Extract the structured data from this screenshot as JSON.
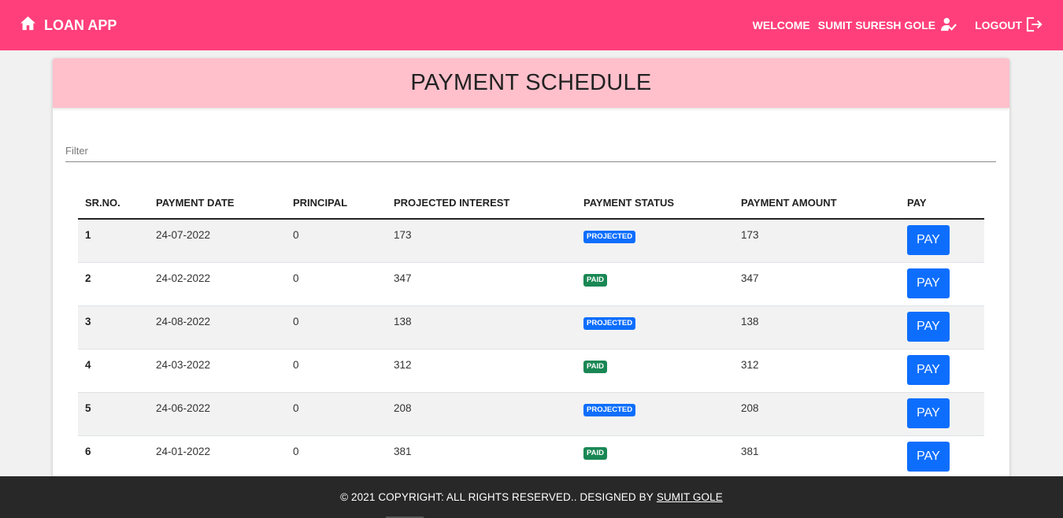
{
  "navbar": {
    "brand": "LOAN APP",
    "welcome": "WELCOME",
    "user": "SUMIT SURESH GOLE",
    "logout": "LOGOUT",
    "color": "#ff3f7b"
  },
  "page": {
    "title": "PAYMENT SCHEDULE",
    "filter_placeholder": "Filter"
  },
  "table": {
    "headers": [
      "SR.NO.",
      "PAYMENT DATE",
      "PRINCIPAL",
      "PROJECTED INTEREST",
      "PAYMENT STATUS",
      "PAYMENT AMOUNT",
      "PAY"
    ],
    "pay_label": "PAY",
    "rows": [
      {
        "sr": "1",
        "date": "24-07-2022",
        "principal": "0",
        "interest": "173",
        "status": "PROJECTED",
        "amount": "173"
      },
      {
        "sr": "2",
        "date": "24-02-2022",
        "principal": "0",
        "interest": "347",
        "status": "PAID",
        "amount": "347"
      },
      {
        "sr": "3",
        "date": "24-08-2022",
        "principal": "0",
        "interest": "138",
        "status": "PROJECTED",
        "amount": "138"
      },
      {
        "sr": "4",
        "date": "24-03-2022",
        "principal": "0",
        "interest": "312",
        "status": "PAID",
        "amount": "312"
      },
      {
        "sr": "5",
        "date": "24-06-2022",
        "principal": "0",
        "interest": "208",
        "status": "PROJECTED",
        "amount": "208"
      },
      {
        "sr": "6",
        "date": "24-01-2022",
        "principal": "0",
        "interest": "381",
        "status": "PAID",
        "amount": "381"
      }
    ]
  },
  "footer": {
    "text": "© 2021 COPYRIGHT: ALL RIGHTS RESERVED.. DESIGNED BY",
    "link": "SUMIT GOLE"
  },
  "icons": {
    "home": "home-icon",
    "user_check": "user-check-icon",
    "logout": "logout-icon"
  }
}
